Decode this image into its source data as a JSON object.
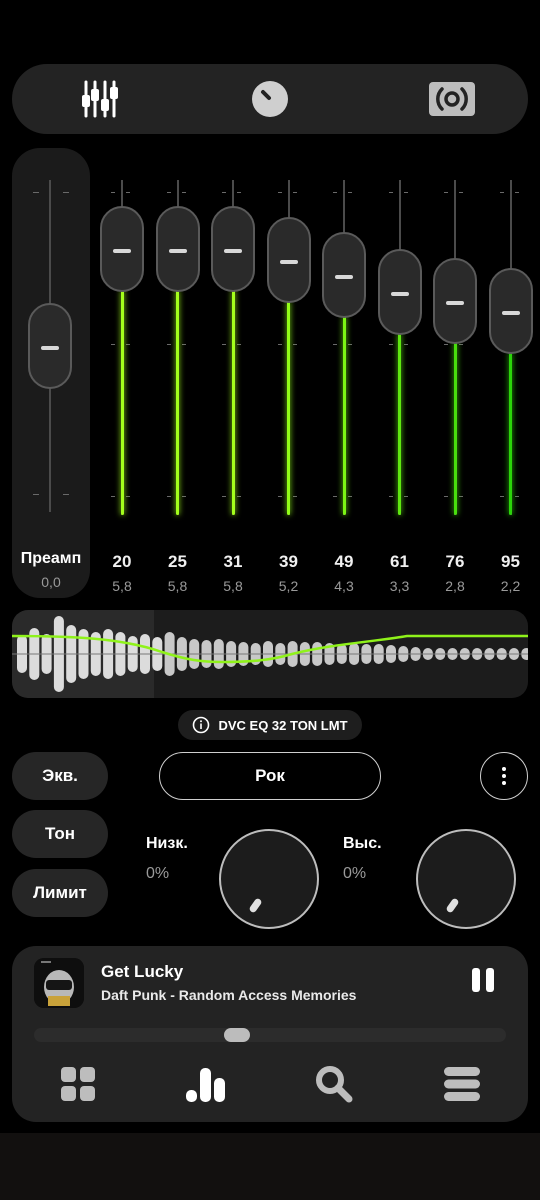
{
  "top_tabs": [
    {
      "name": "equalizer",
      "icon": "sliders-icon"
    },
    {
      "name": "volume",
      "icon": "knob-icon"
    },
    {
      "name": "speaker",
      "icon": "speaker-wave-icon"
    }
  ],
  "preamp": {
    "label": "Преамп",
    "value": "0,0",
    "level": 0.5
  },
  "bands": [
    {
      "freq": "20",
      "gain": "5,8",
      "level": 0.795
    },
    {
      "freq": "25",
      "gain": "5,8",
      "level": 0.795
    },
    {
      "freq": "31",
      "gain": "5,8",
      "level": 0.795
    },
    {
      "freq": "39",
      "gain": "5,2",
      "level": 0.76
    },
    {
      "freq": "49",
      "gain": "4,3",
      "level": 0.715
    },
    {
      "freq": "61",
      "gain": "3,3",
      "level": 0.665
    },
    {
      "freq": "76",
      "gain": "2,8",
      "level": 0.64
    },
    {
      "freq": "95",
      "gain": "2,2",
      "level": 0.61
    }
  ],
  "preset_chip": {
    "icon": "info-icon",
    "text": "DVC EQ 32 TON LMT"
  },
  "side_buttons": {
    "eq": "Экв.",
    "tone": "Тон",
    "limit": "Лимит"
  },
  "preset": {
    "label": "Рок"
  },
  "tone": {
    "bass_label": "Низк.",
    "bass_value": "0%",
    "treble_label": "Выс.",
    "treble_value": "0%"
  },
  "player": {
    "title": "Get Lucky",
    "artist": "Daft Punk - Random Access Memories",
    "progress": 0.43
  },
  "nav": [
    {
      "name": "apps",
      "icon": "grid-icon"
    },
    {
      "name": "equalizer",
      "icon": "bars-icon"
    },
    {
      "name": "search",
      "icon": "search-icon"
    },
    {
      "name": "menu",
      "icon": "stack-icon"
    }
  ],
  "colors": {
    "accent_green": "#a4ff1c",
    "accent_deep_green": "#2bd40a",
    "background": "#000000"
  }
}
